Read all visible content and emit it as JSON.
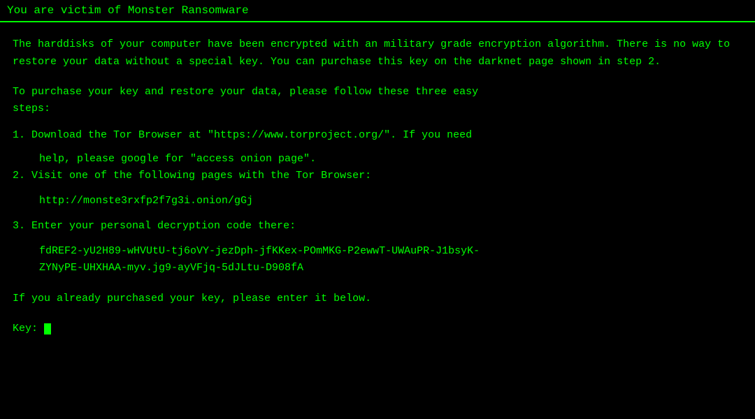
{
  "titleBar": {
    "text": "You are victim of Monster Ransomware"
  },
  "content": {
    "paragraph1": "The harddisks of your computer have been encrypted with an military grade encryption algorithm. There is no way to restore your data without a special key. You can purchase this key on the darknet page shown in step 2.",
    "paragraph2_line1": "To purchase your key and restore your data, please follow these three easy",
    "paragraph2_line2": "steps:",
    "step1_line1": "1. Download the Tor Browser at \"https://www.torproject.org/\". If you need",
    "step1_line2": "   help, please google for \"access onion page\".",
    "step2": "2. Visit one of the following pages with the Tor Browser:",
    "onion_url": "http://monste3rxfp2f7g3i.onion/gGj",
    "step3": "3. Enter your personal decryption code there:",
    "decrypt_code_line1": "fdREF2-yU2H89-wHVUtU-tj6oVY-jezDph-jfKKex-POmMKG-P2ewwT-UWAuPR-J1bsyK-",
    "decrypt_code_line2": "ZYNyPE-UHXHAA-myv.jg9-ayVFjq-5dJLtu-D908fA",
    "already_purchased": "If you already purchased your key, please enter it below.",
    "key_label": "Key: "
  }
}
